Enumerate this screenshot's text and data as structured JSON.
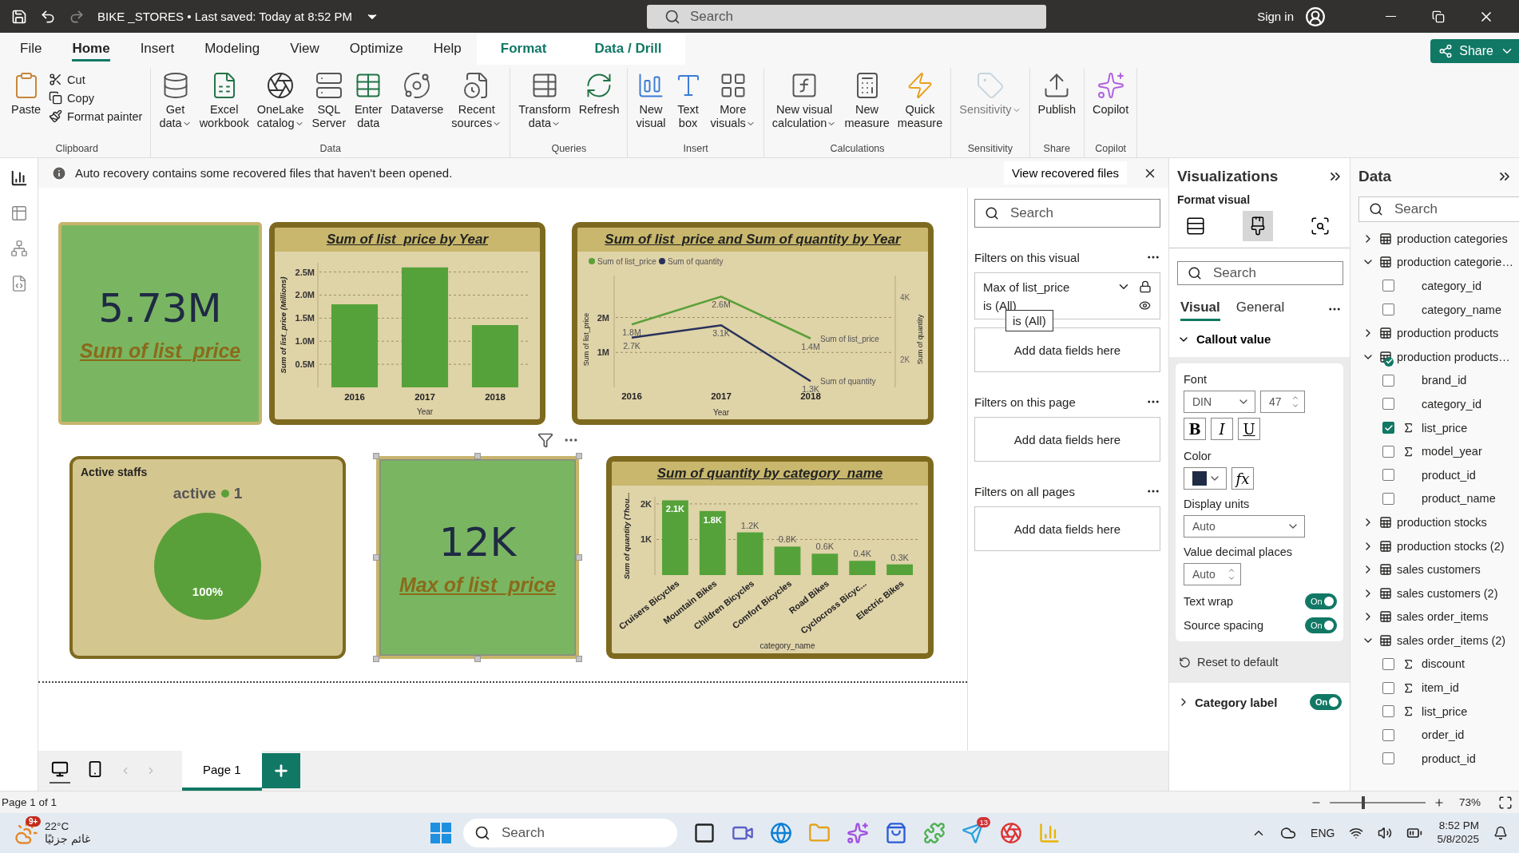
{
  "title_bar": {
    "file_name": "BIKE _STORES",
    "separator": "•",
    "saved": "Last saved: Today at 8:52 PM",
    "search_placeholder": "Search",
    "sign_in": "Sign in"
  },
  "menu_tabs": [
    {
      "label": "File",
      "selected": false,
      "contextual": false
    },
    {
      "label": "Home",
      "selected": true,
      "contextual": false
    },
    {
      "label": "Insert",
      "selected": false,
      "contextual": false
    },
    {
      "label": "Modeling",
      "selected": false,
      "contextual": false
    },
    {
      "label": "View",
      "selected": false,
      "contextual": false
    },
    {
      "label": "Optimize",
      "selected": false,
      "contextual": false
    },
    {
      "label": "Help",
      "selected": false,
      "contextual": false
    },
    {
      "label": "Format",
      "selected": false,
      "contextual": true
    },
    {
      "label": "Data / Drill",
      "selected": false,
      "contextual": true
    }
  ],
  "share": "Share",
  "ribbon": [
    {
      "group": "Clipboard",
      "items": [
        {
          "label": "Paste",
          "dropdown": false,
          "disabled": false
        }
      ],
      "small_items": [
        "Cut",
        "Copy",
        "Format painter"
      ]
    },
    {
      "group": "Data",
      "items": [
        {
          "label": "Get\ndata",
          "dropdown": true,
          "disabled": false
        },
        {
          "label": "Excel\nworkbook",
          "dropdown": false,
          "disabled": false
        },
        {
          "label": "OneLake\ncatalog",
          "dropdown": true,
          "disabled": false
        },
        {
          "label": "SQL\nServer",
          "dropdown": false,
          "disabled": false
        },
        {
          "label": "Enter\ndata",
          "dropdown": false,
          "disabled": false
        },
        {
          "label": "Dataverse",
          "dropdown": false,
          "disabled": false
        },
        {
          "label": "Recent\nsources",
          "dropdown": true,
          "disabled": false
        }
      ]
    },
    {
      "group": "Queries",
      "items": [
        {
          "label": "Transform\ndata",
          "dropdown": true,
          "disabled": false
        },
        {
          "label": "Refresh",
          "dropdown": false,
          "disabled": false
        }
      ]
    },
    {
      "group": "Insert",
      "items": [
        {
          "label": "New\nvisual",
          "dropdown": false,
          "disabled": false
        },
        {
          "label": "Text\nbox",
          "dropdown": false,
          "disabled": false
        },
        {
          "label": "More\nvisuals",
          "dropdown": true,
          "disabled": false
        }
      ]
    },
    {
      "group": "Calculations",
      "items": [
        {
          "label": "New visual\ncalculation",
          "dropdown": true,
          "disabled": false
        },
        {
          "label": "New\nmeasure",
          "dropdown": false,
          "disabled": false
        },
        {
          "label": "Quick\nmeasure",
          "dropdown": false,
          "disabled": false
        }
      ]
    },
    {
      "group": "Sensitivity",
      "items": [
        {
          "label": "Sensitivity",
          "dropdown": true,
          "disabled": true
        }
      ]
    },
    {
      "group": "Share",
      "items": [
        {
          "label": "Publish",
          "dropdown": false,
          "disabled": false
        }
      ]
    },
    {
      "group": "Copilot",
      "items": [
        {
          "label": "Copilot",
          "dropdown": false,
          "disabled": false
        }
      ]
    }
  ],
  "rail": [
    {
      "selected": true
    },
    {
      "selected": false
    },
    {
      "selected": false
    },
    {
      "selected": false
    }
  ],
  "notification": {
    "message": "Auto recovery contains some recovered files that haven't been opened.",
    "action": "View recovered files"
  },
  "visuals": [
    {
      "kind": "card",
      "selected": false,
      "value": "5.73M",
      "label": "Sum of list_price"
    },
    {
      "kind": "chart",
      "selected": false,
      "chart_data": {
        "type": "bar",
        "title": "Sum of list_price by Year",
        "xlabel": "Year",
        "ylabel": "Sum of list_price (Millions)",
        "categories": [
          "2016",
          "2017",
          "2018"
        ],
        "values": [
          1.8,
          2.6,
          1.35
        ],
        "grid": true,
        "ylim": [
          0,
          2.7
        ],
        "yticks": [
          {
            "value": 0.5,
            "label": "0.5M"
          },
          {
            "value": 1,
            "label": "1.0M"
          },
          {
            "value": 1.5,
            "label": "1.5M"
          },
          {
            "value": 2,
            "label": "2.0M"
          },
          {
            "value": 2.5,
            "label": "2.5M"
          }
        ]
      }
    },
    {
      "kind": "chart",
      "selected": false,
      "chart_data": {
        "type": "line",
        "title": "Sum of list_price and Sum of quantity by Year",
        "xlabel": "Year",
        "ylabel": "Sum of list_price",
        "y2label": "Sum of quantity",
        "x": [
          "2016",
          "2017",
          "2018"
        ],
        "grid": true,
        "legend": "top",
        "ylim": [
          0,
          3200000
        ],
        "y2lim": [
          1100,
          4700
        ],
        "annotations": [
          "Sum of list_price",
          "Sum of quantity"
        ],
        "yticks": [
          {
            "value": 1000000,
            "label": "1M"
          },
          {
            "value": 2000000,
            "label": "2M"
          }
        ],
        "y2ticks": [
          {
            "value": 2000,
            "label": "2K"
          },
          {
            "value": 4000,
            "label": "4K"
          }
        ],
        "series": [
          {
            "name": "Sum of list_price",
            "color": "#5aa03a",
            "values": [
              1800000,
              2600000,
              1400000
            ],
            "value_labels": [
              "1.8M",
              "2.6M",
              "1.4M"
            ]
          },
          {
            "name": "Sum of quantity",
            "axis": "y2",
            "color": "#27315a",
            "values": [
              2700,
              3100,
              1300
            ],
            "value_labels": [
              "2.7K",
              "3.1K",
              "1.3K"
            ]
          }
        ]
      }
    },
    {
      "kind": "chart",
      "selected": false,
      "chart_data": {
        "type": "pie",
        "title": "Active staffs",
        "legend_title": "active",
        "categories": [
          "1"
        ],
        "values": [
          1
        ],
        "colors": [
          "#5aa03a"
        ],
        "value_labels": [
          "100%"
        ]
      }
    },
    {
      "kind": "card",
      "selected": true,
      "value": "12K",
      "label": "Max of list_price"
    },
    {
      "kind": "chart",
      "selected": false,
      "chart_data": {
        "type": "bar",
        "title": "Sum of quantity by category_name",
        "xlabel": "category_name",
        "ylabel": "Sum of quantity (Thou...",
        "categories": [
          "Cruisers Bicycles",
          "Mountain Bikes",
          "Children Bicycles",
          "Comfort Bicycles",
          "Road Bikes",
          "Cyclocross Bicyc...",
          "Electric Bikes"
        ],
        "values": [
          2100,
          1800,
          1200,
          800,
          600,
          400,
          300
        ],
        "grid": true,
        "ylim": [
          0,
          2200
        ],
        "yticks": [
          {
            "value": 1000,
            "label": "1K"
          },
          {
            "value": 2000,
            "label": "2K"
          }
        ],
        "value_labels": [
          "2.1K",
          "1.8K",
          "1.2K",
          "0.8K",
          "0.6K",
          "0.4K",
          "0.3K"
        ]
      }
    }
  ],
  "filters": {
    "search_placeholder": "Search",
    "sections": [
      {
        "title": "Filters on this visual",
        "cards": [
          {
            "field": "Max of list_price",
            "condition": "is (All)",
            "tooltip": "is (All)"
          }
        ],
        "drop_hint": "Add data fields here"
      },
      {
        "title": "Filters on this page",
        "drop_hint": "Add data fields here"
      },
      {
        "title": "Filters on all pages",
        "drop_hint": "Add data fields here"
      }
    ]
  },
  "visualizations": {
    "title": "Visualizations",
    "subtitle": "Format visual",
    "modes": [
      {
        "selected": false
      },
      {
        "selected": true
      },
      {
        "selected": false
      }
    ],
    "search_placeholder": "Search",
    "tabs": [
      {
        "label": "Visual",
        "selected": true
      },
      {
        "label": "General",
        "selected": false
      }
    ],
    "callout": {
      "title": "Callout value",
      "expanded": true,
      "font_label": "Font",
      "font": "DIN",
      "size": "47",
      "styles": [
        "B",
        "I",
        "U"
      ],
      "color_label": "Color",
      "color": "#1f2a44",
      "fx": "fx",
      "units_label": "Display units",
      "units": "Auto",
      "decimals_label": "Value decimal places",
      "decimals": "Auto",
      "toggles": [
        {
          "label": "Text wrap",
          "on": true,
          "text": "On"
        },
        {
          "label": "Source spacing",
          "on": true,
          "text": "On"
        }
      ]
    },
    "reset": "Reset to default",
    "category_label": {
      "title": "Category label",
      "expanded": false,
      "on": true,
      "text": "On"
    }
  },
  "data": {
    "title": "Data",
    "search_placeholder": "Search",
    "tables": [
      {
        "name": "production categories",
        "expanded": false,
        "badge": false
      },
      {
        "name": "production categorie…",
        "expanded": true,
        "badge": false,
        "fields": [
          {
            "name": "category_id",
            "summed": false,
            "checked": false
          },
          {
            "name": "category_name",
            "summed": false,
            "checked": false
          }
        ]
      },
      {
        "name": "production products",
        "expanded": false,
        "badge": false
      },
      {
        "name": "production products…",
        "expanded": true,
        "badge": true,
        "fields": [
          {
            "name": "brand_id",
            "summed": false,
            "checked": false
          },
          {
            "name": "category_id",
            "summed": false,
            "checked": false
          },
          {
            "name": "list_price",
            "summed": true,
            "checked": true
          },
          {
            "name": "model_year",
            "summed": true,
            "checked": false
          },
          {
            "name": "product_id",
            "summed": false,
            "checked": false
          },
          {
            "name": "product_name",
            "summed": false,
            "checked": false
          }
        ]
      },
      {
        "name": "production stocks",
        "expanded": false,
        "badge": false
      },
      {
        "name": "production stocks (2)",
        "expanded": false,
        "badge": false
      },
      {
        "name": "sales customers",
        "expanded": false,
        "badge": false
      },
      {
        "name": "sales customers (2)",
        "expanded": false,
        "badge": false
      },
      {
        "name": "sales order_items",
        "expanded": false,
        "badge": false
      },
      {
        "name": "sales order_items (2)",
        "expanded": true,
        "badge": false,
        "fields": [
          {
            "name": "discount",
            "summed": true,
            "checked": false
          },
          {
            "name": "item_id",
            "summed": true,
            "checked": false
          },
          {
            "name": "list_price",
            "summed": true,
            "checked": false
          },
          {
            "name": "order_id",
            "summed": false,
            "checked": false
          },
          {
            "name": "product_id",
            "summed": false,
            "checked": false
          }
        ]
      }
    ]
  },
  "page_bar": {
    "views": [
      {
        "selected": true
      },
      {
        "selected": false
      }
    ],
    "pages": [
      {
        "label": "Page 1",
        "selected": true
      }
    ]
  },
  "status": {
    "page": "Page 1 of 1",
    "zoom": "73%",
    "level": 0.35
  },
  "taskbar": {
    "weather_badge": "9+",
    "temperature": "22°C",
    "weather": "غائم جزئيًا",
    "search_placeholder": "Search",
    "app_badge": "13",
    "language": "ENG",
    "time": "8:52 PM",
    "date": "5/8/2025"
  }
}
